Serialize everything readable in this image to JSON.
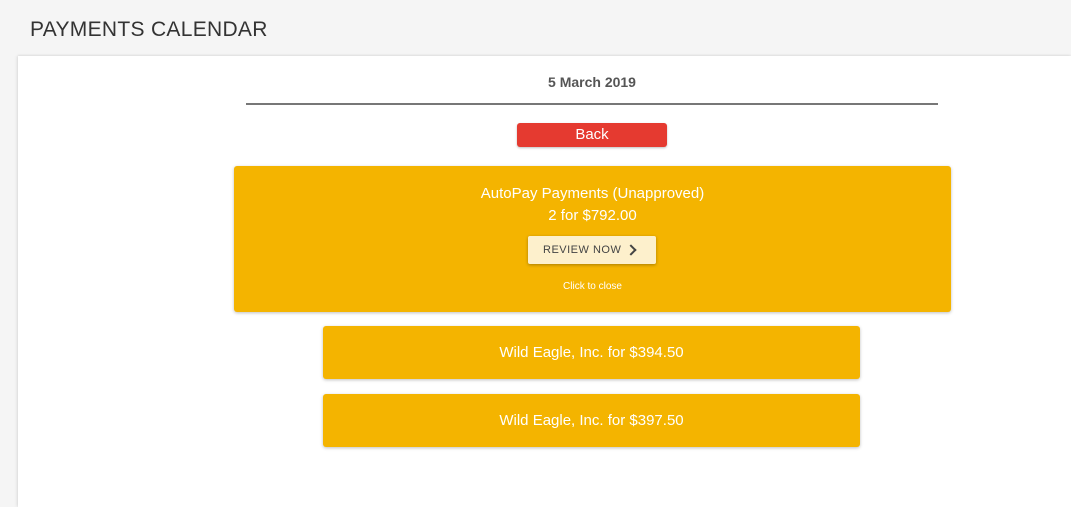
{
  "header": {
    "title": "PAYMENTS CALENDAR"
  },
  "calendar": {
    "date": "5 March 2019",
    "back_label": "Back"
  },
  "autopay": {
    "title": "AutoPay Payments (Unapproved)",
    "summary": "2 for $792.00",
    "review_label": "REVIEW NOW",
    "review_icon": "chevron-right-icon",
    "close_hint": "Click to close"
  },
  "payments": [
    {
      "label": "Wild Eagle, Inc. for $394.50"
    },
    {
      "label": "Wild Eagle, Inc. for $397.50"
    }
  ],
  "colors": {
    "card": "#f4b400",
    "back_button": "#e53a30",
    "review_button": "#fdf0cc"
  }
}
